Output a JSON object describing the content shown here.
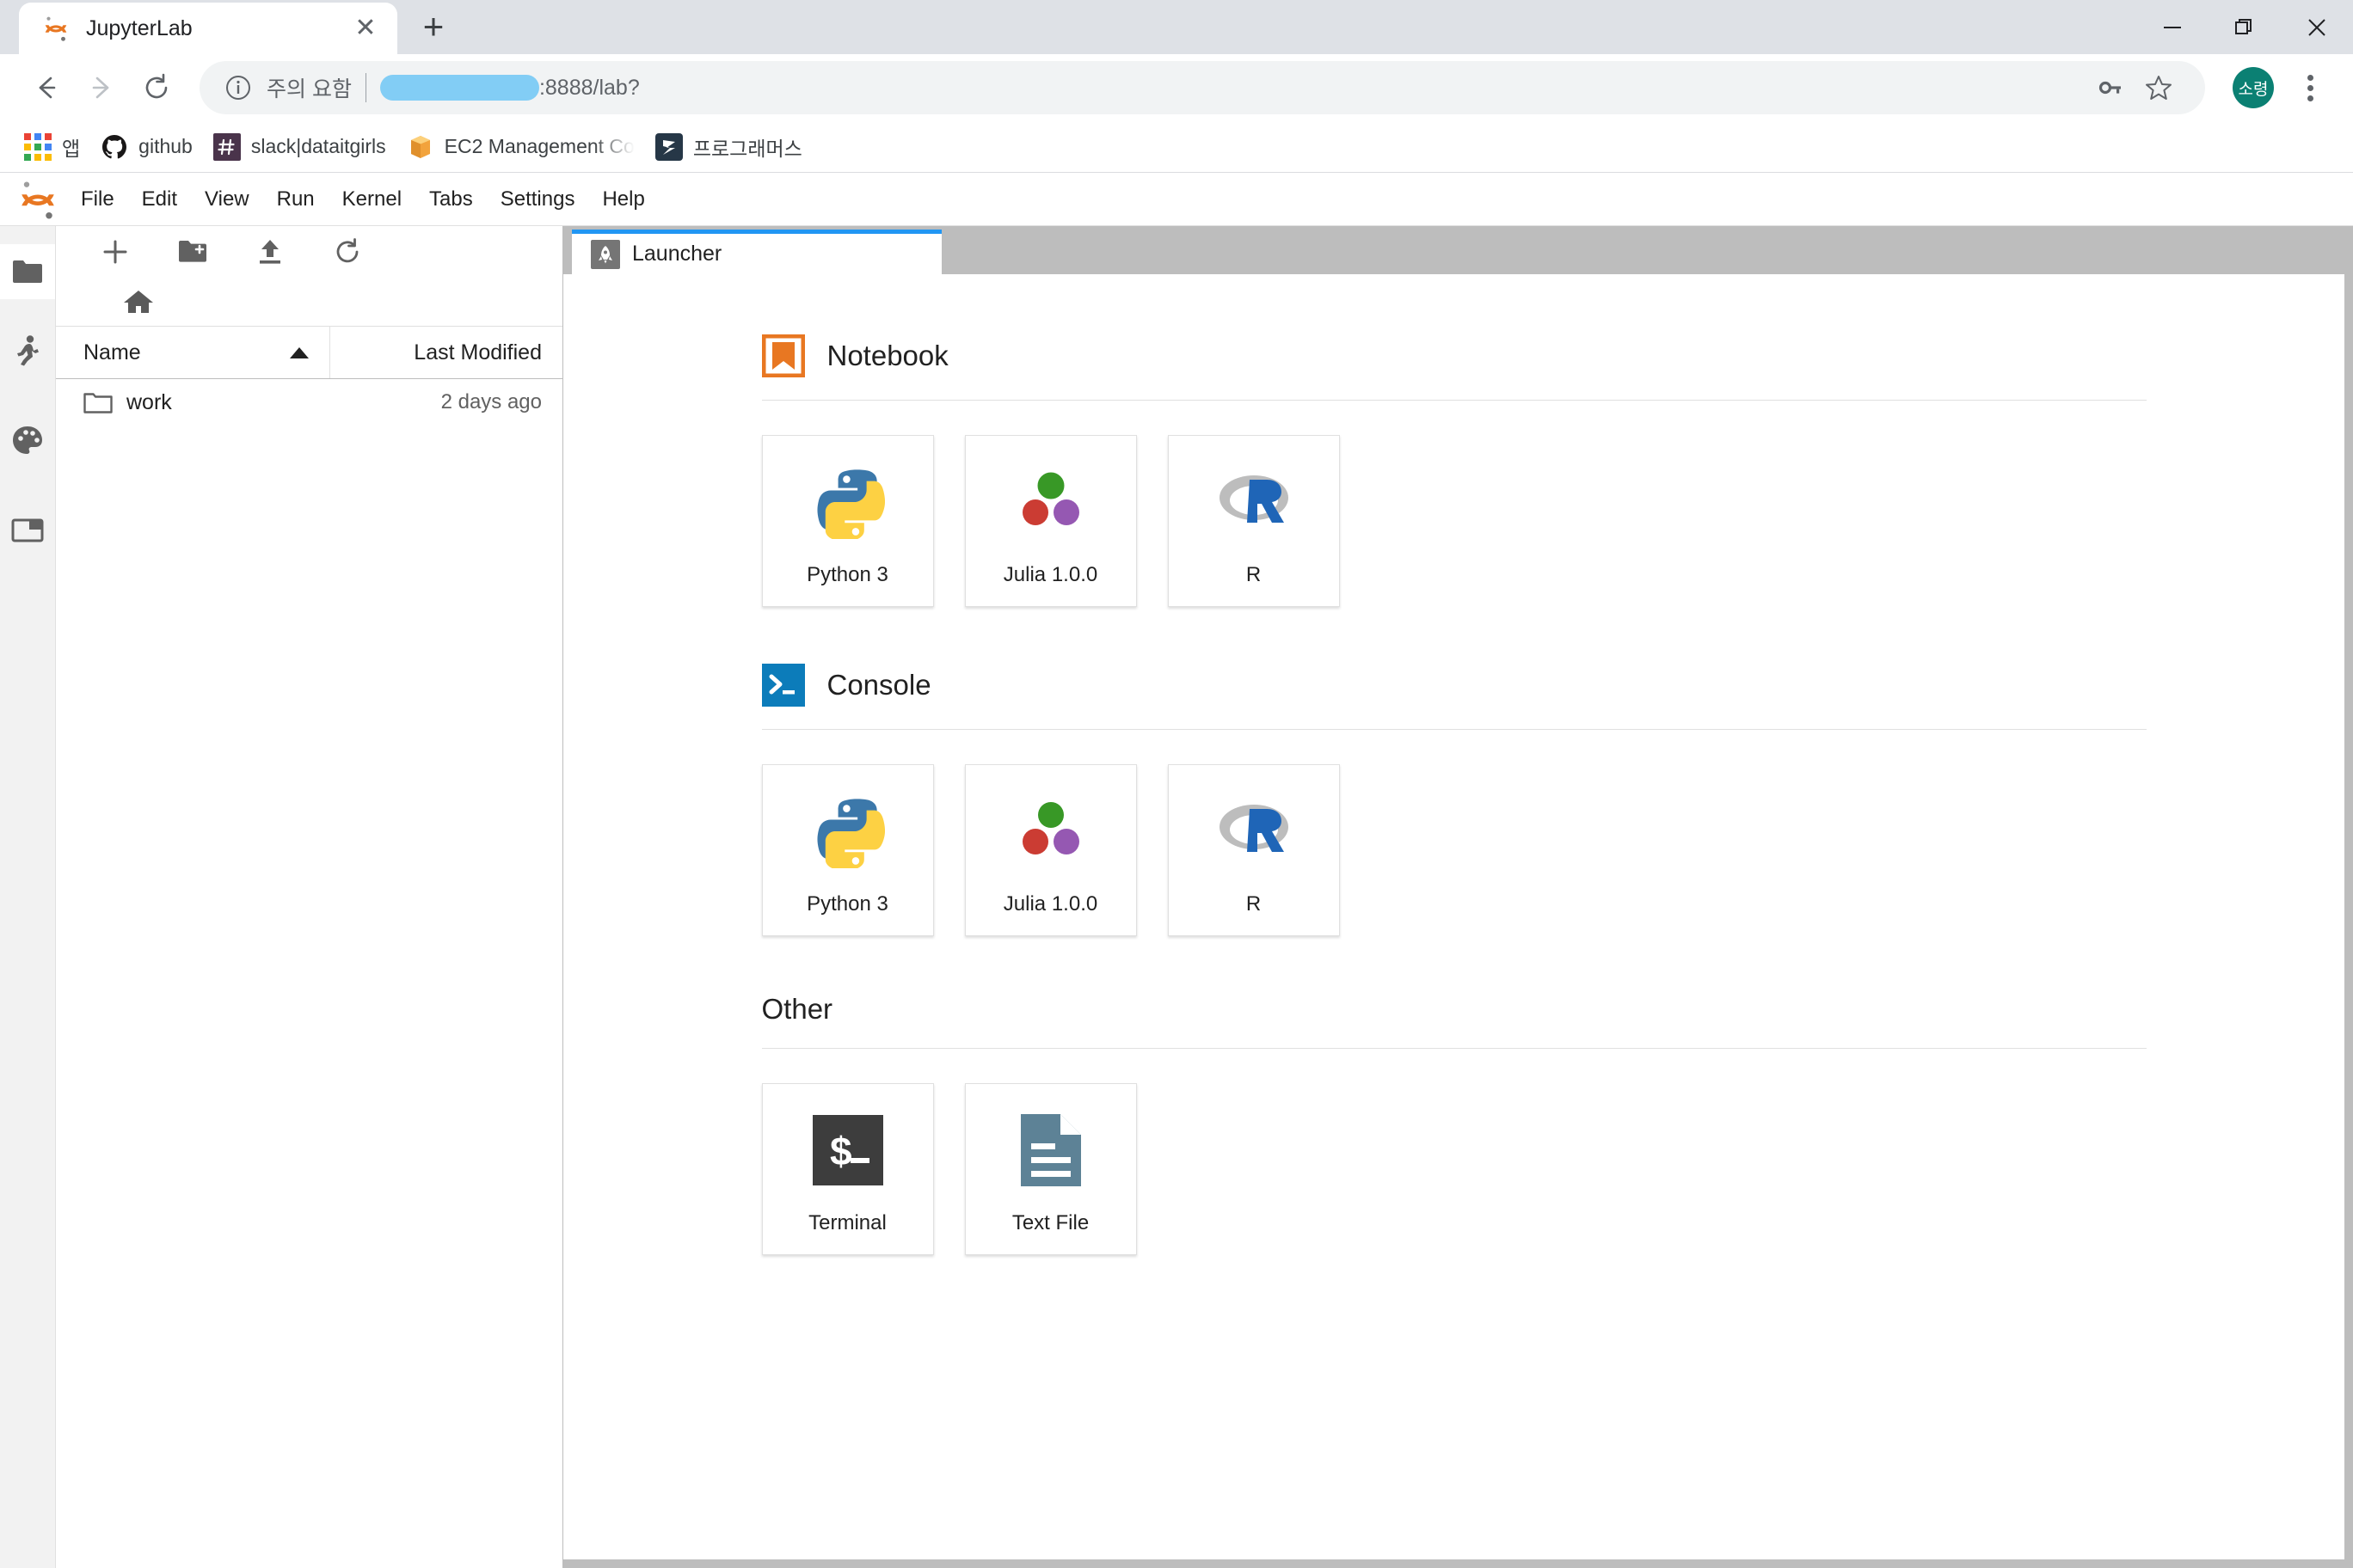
{
  "browser": {
    "tab": {
      "title": "JupyterLab",
      "favicon": "jupyter-logo-icon",
      "close_label": "✕"
    },
    "new_tab_label": "+",
    "window_controls": {
      "minimize": "minimize-icon",
      "maximize": "maximize-icon",
      "close": "close-icon"
    },
    "nav": {
      "back": "back-arrow-icon",
      "forward": "forward-arrow-icon",
      "reload": "reload-icon"
    },
    "omnibox": {
      "info_icon": "info-circle-icon",
      "security_label": "주의 요함",
      "url_redacted": true,
      "url_suffix": ":8888/lab?",
      "key_icon": "key-icon",
      "star_icon": "star-icon"
    },
    "profile": {
      "initials": "소령",
      "color": "#0b8073"
    },
    "menu_icon": "three-dots-menu-icon",
    "bookmarks": [
      {
        "label": "앱",
        "icon": "apps-grid-icon"
      },
      {
        "label": "github",
        "icon": "github-icon"
      },
      {
        "label": "slack|dataitgirls",
        "icon": "slack-hash-icon"
      },
      {
        "label": "EC2 Management Co",
        "icon": "aws-cube-icon",
        "truncated": true
      },
      {
        "label": "프로그래머스",
        "icon": "programmers-icon"
      }
    ]
  },
  "jupyterlab": {
    "logo": "jupyter-logo-icon",
    "menubar": [
      "File",
      "Edit",
      "View",
      "Run",
      "Kernel",
      "Tabs",
      "Settings",
      "Help"
    ],
    "rail": [
      {
        "name": "file-browser",
        "icon": "folder-icon",
        "active": true
      },
      {
        "name": "running-terminals-kernels",
        "icon": "running-person-icon",
        "active": false
      },
      {
        "name": "commands-palette",
        "icon": "palette-icon",
        "active": false
      },
      {
        "name": "open-tabs",
        "icon": "tabs-icon",
        "active": false
      }
    ],
    "file_browser": {
      "toolbar": [
        {
          "name": "new-launcher",
          "icon": "plus-icon"
        },
        {
          "name": "new-folder",
          "icon": "new-folder-icon"
        },
        {
          "name": "upload",
          "icon": "upload-icon"
        },
        {
          "name": "refresh",
          "icon": "refresh-icon"
        }
      ],
      "breadcrumb_home_icon": "home-icon",
      "columns": {
        "name": "Name",
        "last_modified": "Last Modified"
      },
      "sort": {
        "column": "Name",
        "direction": "asc"
      },
      "rows": [
        {
          "name": "work",
          "type": "folder",
          "last_modified": "2 days ago"
        }
      ]
    },
    "tabs": [
      {
        "label": "Launcher",
        "icon": "rocket-launcher-icon",
        "active": true
      }
    ],
    "launcher": {
      "sections": [
        {
          "title": "Notebook",
          "icon": "notebook-bookmark-icon",
          "icon_color": "#e87722",
          "cards": [
            {
              "label": "Python 3",
              "icon": "python-logo-icon"
            },
            {
              "label": "Julia 1.0.0",
              "icon": "julia-logo-icon"
            },
            {
              "label": "R",
              "icon": "r-logo-icon"
            }
          ]
        },
        {
          "title": "Console",
          "icon": "console-prompt-icon",
          "icon_color": "#0c7cba",
          "cards": [
            {
              "label": "Python 3",
              "icon": "python-logo-icon"
            },
            {
              "label": "Julia 1.0.0",
              "icon": "julia-logo-icon"
            },
            {
              "label": "R",
              "icon": "r-logo-icon"
            }
          ]
        },
        {
          "title": "Other",
          "icon": null,
          "cards": [
            {
              "label": "Terminal",
              "icon": "terminal-icon"
            },
            {
              "label": "Text File",
              "icon": "text-file-icon"
            }
          ]
        }
      ]
    }
  }
}
